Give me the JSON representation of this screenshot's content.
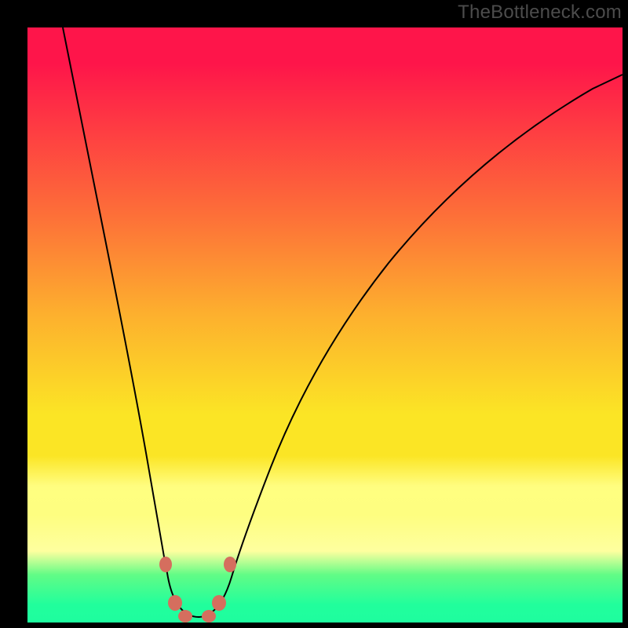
{
  "watermark": "TheBottleneck.com",
  "chart_data": {
    "type": "line",
    "title": "",
    "xlabel": "",
    "ylabel": "",
    "xlim": [
      0,
      100
    ],
    "ylim": [
      0,
      100
    ],
    "description": "Single V-shaped bottleneck curve on a vertical heat gradient background (red high, green low). Minimum near x≈28, y≈0. Left branch nearly vertical from (≈6,100) down to the trough; right branch rises with decreasing slope to (≈100,≈92).",
    "series": [
      {
        "name": "bottleneck-curve",
        "x": [
          6,
          10,
          14,
          18,
          20,
          22,
          24,
          26,
          27,
          28,
          29,
          30,
          32,
          34,
          38,
          42,
          48,
          55,
          62,
          70,
          80,
          90,
          100
        ],
        "y": [
          100,
          80,
          60,
          42,
          34,
          25,
          17,
          9,
          4,
          1,
          1,
          4,
          9,
          14,
          25,
          34,
          45,
          55,
          63,
          71,
          79,
          86,
          92
        ]
      }
    ],
    "markers": [
      {
        "x": 23,
        "y": 10,
        "color": "#d56e5e"
      },
      {
        "x": 34,
        "y": 10,
        "color": "#d56e5e"
      },
      {
        "x": 25,
        "y": 3,
        "color": "#d56e5e"
      },
      {
        "x": 32,
        "y": 3,
        "color": "#d56e5e"
      },
      {
        "x": 27,
        "y": 1,
        "color": "#d56e5e"
      },
      {
        "x": 30,
        "y": 1,
        "color": "#d56e5e"
      }
    ],
    "background_gradient": {
      "direction": "vertical",
      "stops": [
        {
          "pos": 0.0,
          "color": "#fe154a"
        },
        {
          "pos": 0.32,
          "color": "#fd7138"
        },
        {
          "pos": 0.48,
          "color": "#fdaf2e"
        },
        {
          "pos": 0.68,
          "color": "#fbe525"
        },
        {
          "pos": 0.8,
          "color": "#fffd7f"
        },
        {
          "pos": 0.88,
          "color": "#feff9f"
        },
        {
          "pos": 0.92,
          "color": "#61fc86"
        },
        {
          "pos": 1.0,
          "color": "#1efd9f"
        }
      ]
    },
    "frame_color": "#000000",
    "curve_color": "#000000",
    "marker_color": "#d56e5e"
  }
}
